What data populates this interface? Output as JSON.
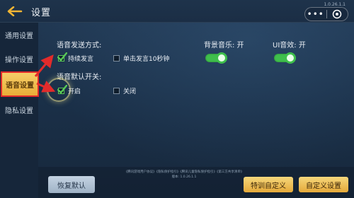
{
  "header": {
    "title": "设置",
    "version": "1.0.26.1.1",
    "menu_dots": "•••"
  },
  "sidebar": {
    "items": [
      {
        "label": "通用设置",
        "active": false
      },
      {
        "label": "操作设置",
        "active": false
      },
      {
        "label": "语音设置",
        "active": true
      },
      {
        "label": "隐私设置",
        "active": false
      }
    ]
  },
  "voice": {
    "send_mode_label": "语音发送方式:",
    "send_mode_options": [
      {
        "label": "持续发言",
        "checked": true
      },
      {
        "label": "单击发言10秒钟",
        "checked": false
      }
    ],
    "default_switch_label": "语音默认开关:",
    "default_switch_options": [
      {
        "label": "开启",
        "checked": true
      },
      {
        "label": "关闭",
        "checked": false
      }
    ]
  },
  "audio": {
    "bgm_label": "背景音乐: 开",
    "bgm_on": true,
    "ui_sfx_label": "UI音效: 开",
    "ui_sfx_on": true
  },
  "footer": {
    "links": "《腾讯游戏用户协议》《隐私保护指引》《腾讯儿童隐私保护指引》《第三方共享清单》",
    "version_line": "版本: 1.0.26.1.1",
    "reset_label": "恢复默认",
    "training_label": "特训自定义",
    "custom_label": "自定义设置"
  },
  "colors": {
    "accent_gold": "#e9ad36",
    "toggle_green": "#3fbf4c",
    "check_green": "#59c957",
    "annotation_red": "#e22b2b"
  }
}
